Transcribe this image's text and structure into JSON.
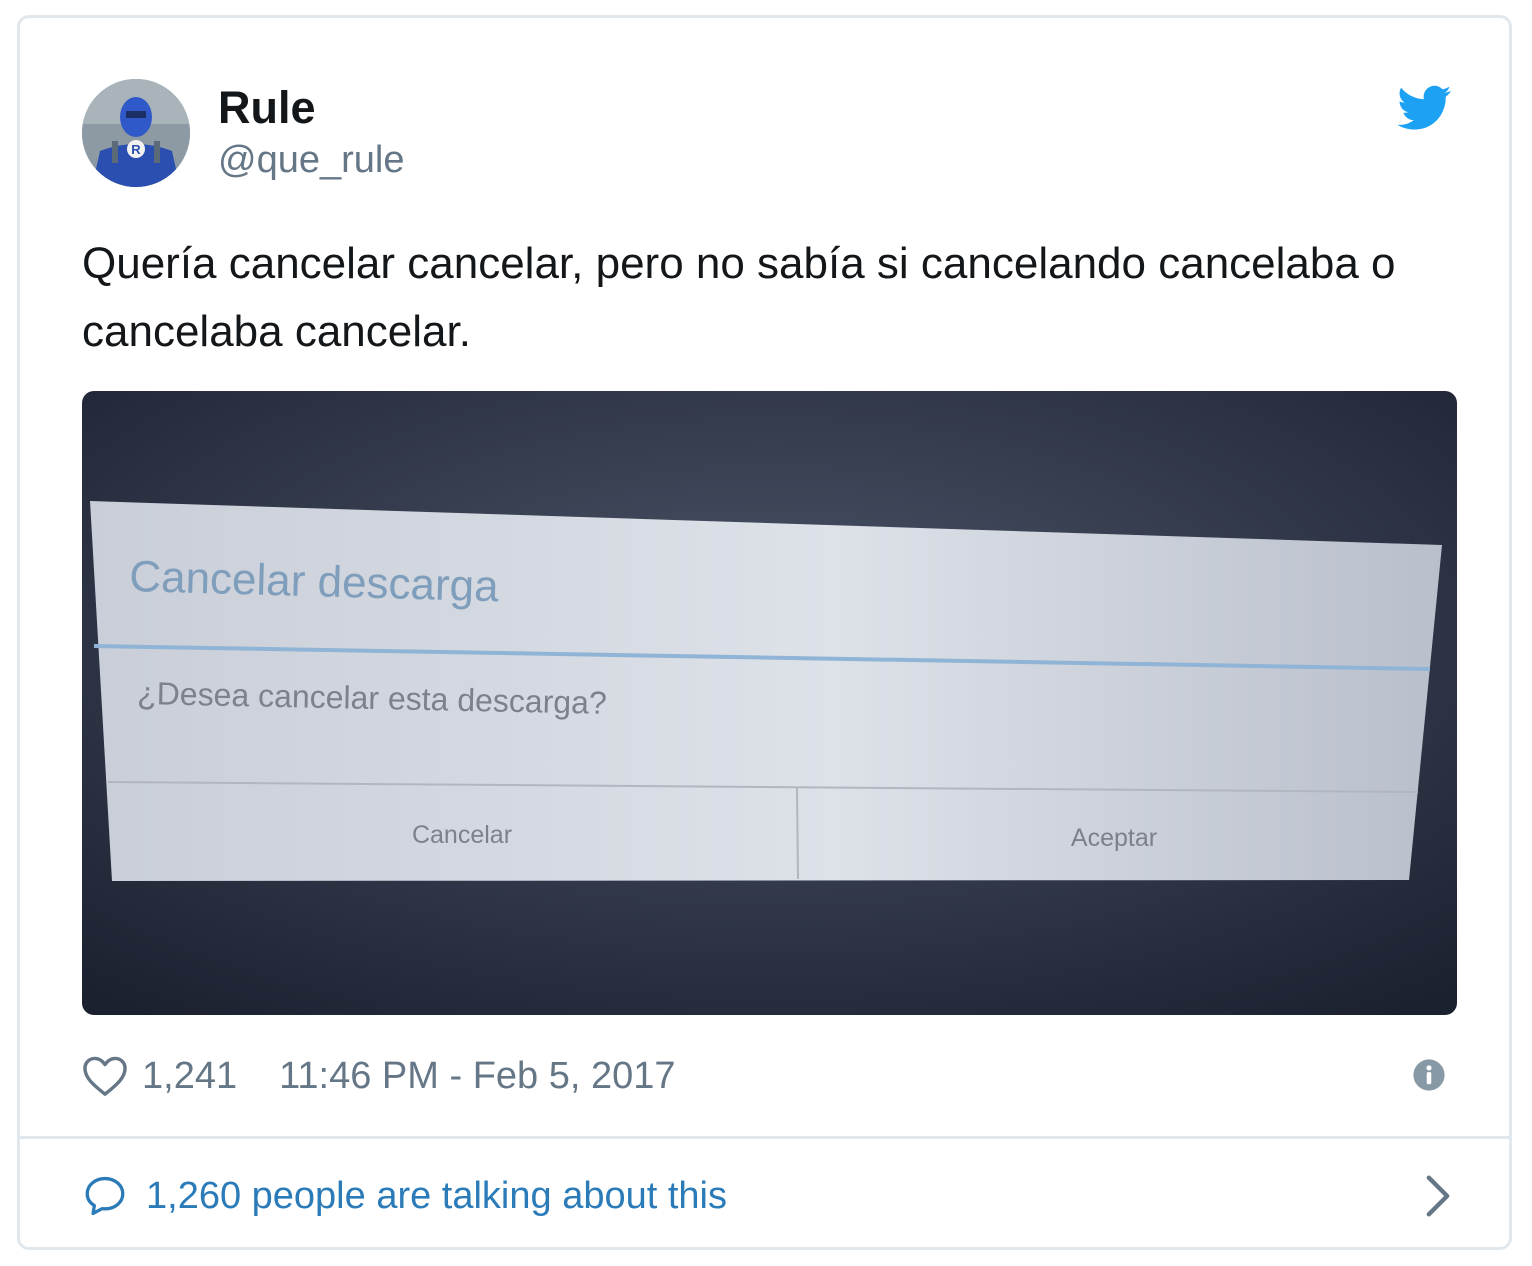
{
  "author": {
    "name": "Rule",
    "handle": "@que_rule",
    "avatar_badge": "R"
  },
  "tweet": {
    "text": "Quería cancelar cancelar, pero no sabía si cancelando cancelaba o cancelaba cancelar."
  },
  "media": {
    "dialog_title": "Cancelar descarga",
    "dialog_message": "¿Desea cancelar esta descarga?",
    "cancel_button": "Cancelar",
    "accept_button": "Aceptar"
  },
  "meta": {
    "likes": "1,241",
    "timestamp": "11:46 PM - Feb 5, 2017"
  },
  "footer": {
    "text": "1,260 people are talking about this"
  },
  "icons": {
    "brand": "twitter-bird-icon",
    "like": "heart-icon",
    "info": "info-icon",
    "reply": "speech-bubble-icon",
    "more": "chevron-right-icon"
  },
  "colors": {
    "brand_blue": "#1da1f2",
    "link_blue": "#2b7bb9",
    "muted_gray": "#657786",
    "text_dark": "#14171a",
    "border": "#e1e8ed"
  }
}
